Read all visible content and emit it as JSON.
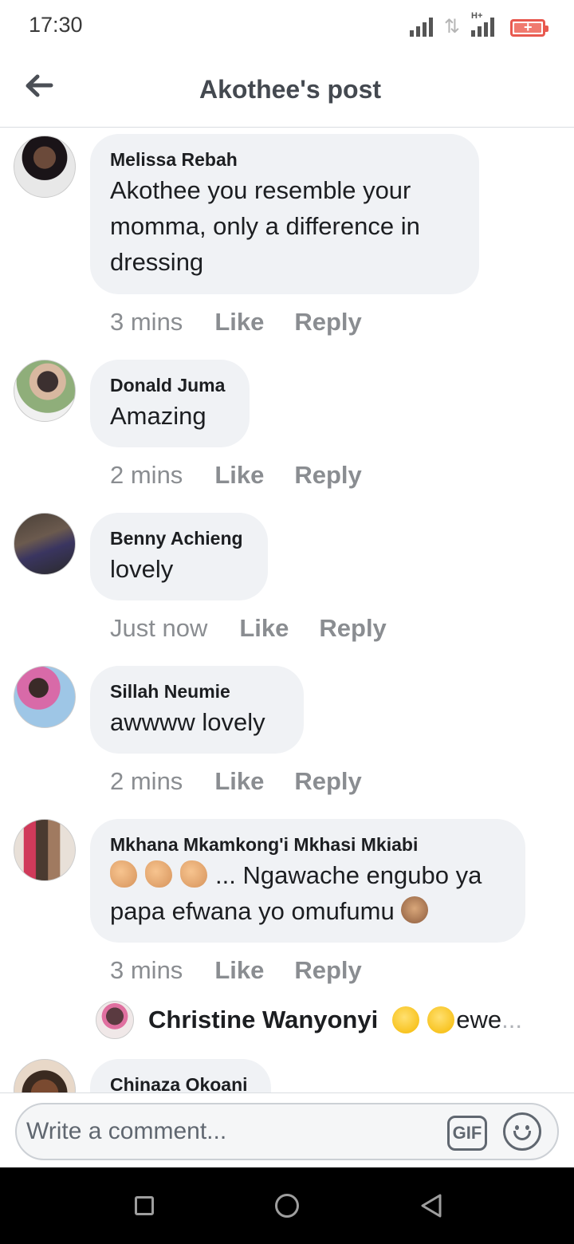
{
  "status_bar": {
    "time": "17:30",
    "network_label": "H+",
    "icons": [
      "signal-icon",
      "data-arrows-icon",
      "hplus-signal-icon",
      "battery-charging-icon"
    ],
    "battery_color": "#e8594f"
  },
  "header": {
    "title": "Akothee's post",
    "back_icon": "arrow-left-icon"
  },
  "comments": [
    {
      "name": "Melissa Rebah",
      "text_lines": [
        "Akothee  you  resemble your",
        "momma,  only a difference in",
        "dressing"
      ],
      "time": "3 mins",
      "like": "Like",
      "reply": "Reply"
    },
    {
      "name": "Donald Juma",
      "text_lines": [
        "Amazing"
      ],
      "time": "2 mins",
      "like": "Like",
      "reply": "Reply"
    },
    {
      "name": "Benny Achieng",
      "text_lines": [
        "lovely"
      ],
      "time": "Just now",
      "like": "Like",
      "reply": "Reply"
    },
    {
      "name": "Sillah Neumie",
      "text_lines": [
        "awwww lovely"
      ],
      "time": "2 mins",
      "like": "Like",
      "reply": "Reply"
    },
    {
      "name": "Mkhana Mkamkong'i Mkhasi Mkiabi",
      "text_lines": [
        "... Ngawache engubo ya",
        "papa efwana yo omufumu"
      ],
      "emojis": [
        "clapping-hands-emoji",
        "clapping-hands-emoji",
        "clapping-hands-emoji",
        "speak-no-evil-monkey-emoji"
      ],
      "time": "3 mins",
      "like": "Like",
      "reply": "Reply",
      "reply_preview": {
        "name": "Christine Wanyonyi",
        "text": "ewe",
        "ellipsis": "...",
        "emojis": [
          "shushing-face-emoji",
          "shushing-face-emoji"
        ]
      }
    },
    {
      "name": "Chinaza Okoani"
    }
  ],
  "composer": {
    "placeholder": "Write a comment...",
    "gif_label": "GIF",
    "emoji_icon": "smiley-icon"
  },
  "nav_bar": {
    "icons": [
      "recents-square-icon",
      "home-circle-icon",
      "back-triangle-icon"
    ]
  }
}
